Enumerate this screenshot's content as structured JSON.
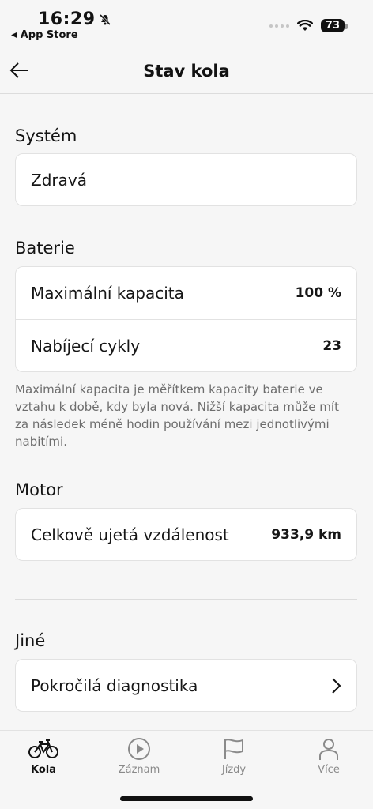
{
  "status_bar": {
    "time": "16:29",
    "back_app": "App Store",
    "battery": "73"
  },
  "header": {
    "title": "Stav kola"
  },
  "system": {
    "heading": "Systém",
    "status": "Zdravá"
  },
  "battery_section": {
    "heading": "Baterie",
    "rows": [
      {
        "label": "Maximální kapacita",
        "value": "100 %"
      },
      {
        "label": "Nabíjecí cykly",
        "value": "23"
      }
    ],
    "description": "Maximální kapacita je měřítkem kapacity baterie ve vztahu k době, kdy byla nová. Nižší kapacita může mít za následek méně hodin používání mezi jednotlivými nabitími."
  },
  "motor": {
    "heading": "Motor",
    "rows": [
      {
        "label": "Celkově ujetá vzdálenost",
        "value": "933,9 km"
      }
    ]
  },
  "other": {
    "heading": "Jiné",
    "rows": [
      {
        "label": "Pokročilá diagnostika"
      }
    ]
  },
  "tabs": [
    {
      "label": "Kola",
      "icon": "bike-icon",
      "active": true
    },
    {
      "label": "Záznam",
      "icon": "play-icon",
      "active": false
    },
    {
      "label": "Jízdy",
      "icon": "flag-icon",
      "active": false
    },
    {
      "label": "Více",
      "icon": "person-icon",
      "active": false
    }
  ]
}
